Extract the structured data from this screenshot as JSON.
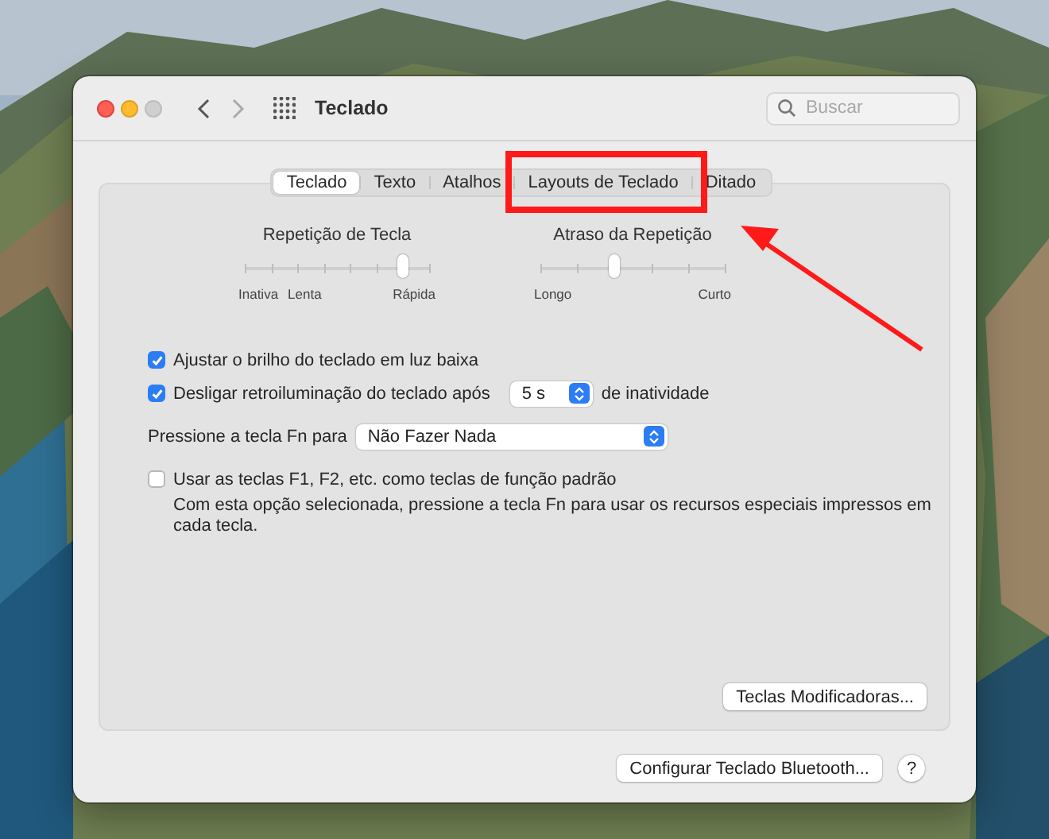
{
  "window": {
    "title": "Teclado",
    "search": {
      "placeholder": "Buscar"
    }
  },
  "tabs": [
    {
      "label": "Teclado",
      "selected": true
    },
    {
      "label": "Texto",
      "selected": false
    },
    {
      "label": "Atalhos",
      "selected": false
    },
    {
      "label": "Layouts de Teclado",
      "selected": false
    },
    {
      "label": "Ditado",
      "selected": false
    }
  ],
  "sliders": [
    {
      "label": "Repetição de Tecla",
      "level": 0.857,
      "marks": [
        "Inativa",
        "Lenta",
        "Rápida"
      ]
    },
    {
      "label": "Atraso da Repetição",
      "level": 0.4,
      "marks": [
        "Longo",
        "Curto"
      ]
    }
  ],
  "options": [
    {
      "kind": "checkbox",
      "label": "Ajustar o brilho do teclado em luz baixa",
      "checked": true
    },
    {
      "kind": "checkbox-select",
      "label": "Desligar retroiluminação do teclado após",
      "checked": true,
      "value": "5 s",
      "suffix": "de inatividade"
    },
    {
      "kind": "select",
      "label": "Pressione a tecla Fn para",
      "value": "Não Fazer Nada"
    },
    {
      "kind": "checkbox",
      "label": "Usar as teclas F1, F2, etc. como teclas de função padrão",
      "checked": false,
      "description": "Com esta opção selecionada, pressione a tecla Fn para usar os recursos especiais impressos em cada tecla."
    }
  ],
  "panel_button": "Teclas Modificadoras...",
  "footer": {
    "button": "Configurar Teclado Bluetooth...",
    "help": "?"
  }
}
